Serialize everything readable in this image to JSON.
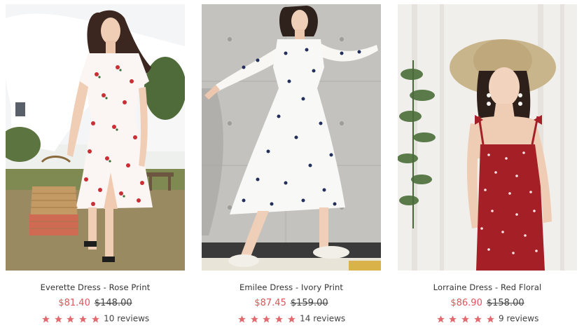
{
  "colors": {
    "sale_price": "#e0545a",
    "star": "#e26b70",
    "text": "#333333"
  },
  "products": [
    {
      "image_alt": "Woman in white dress with red floral print holding a woven basket",
      "name": "Everette Dress - Rose Print",
      "sale_price": "$81.40",
      "original_price": "$148.00",
      "rating": 5,
      "reviews": "10 reviews"
    },
    {
      "image_alt": "Woman in ivory dress with navy flowers walking by a concrete wall",
      "name": "Emilee Dress - Ivory Print",
      "sale_price": "$87.45",
      "original_price": "$159.00",
      "rating": 5,
      "reviews": "14 reviews"
    },
    {
      "image_alt": "Woman in red floral slip dress wearing a straw hat",
      "name": "Lorraine Dress - Red Floral",
      "sale_price": "$86.90",
      "original_price": "$158.00",
      "rating": 5,
      "reviews": "9 reviews"
    }
  ]
}
